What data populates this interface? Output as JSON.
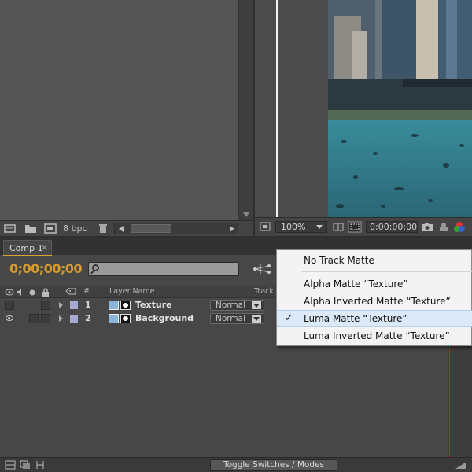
{
  "project": {
    "bit_depth": "8 bpc"
  },
  "viewer": {
    "zoom": "100%",
    "timecode": "0;00;00;00"
  },
  "timeline": {
    "tab_label": "Comp 1",
    "tab_close": "×",
    "timecode": "0;00;00;00",
    "columns": {
      "number": "#",
      "layer_name": "Layer Name",
      "track": "Track"
    },
    "layers": [
      {
        "number": "1",
        "name": "Texture",
        "mode": "Normal",
        "visible": false
      },
      {
        "number": "2",
        "name": "Background",
        "mode": "Normal",
        "visible": true
      }
    ],
    "toggle_label": "Toggle Switches / Modes"
  },
  "track_matte_menu": {
    "items": [
      {
        "label": "No Track Matte",
        "checked": false
      },
      {
        "label": "Alpha Matte “Texture”",
        "checked": false
      },
      {
        "label": "Alpha Inverted Matte “Texture”",
        "checked": false
      },
      {
        "label": "Luma Matte “Texture”",
        "checked": true
      },
      {
        "label": "Luma Inverted Matte “Texture”",
        "checked": false
      }
    ],
    "check_glyph": "✓"
  },
  "colors": {
    "accent": "#d49b2d",
    "playhead": "#cc2222",
    "label_swatch": "#a7a7d6"
  }
}
